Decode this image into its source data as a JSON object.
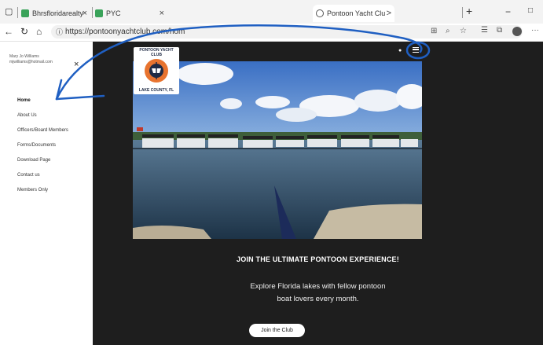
{
  "browser": {
    "tabs": [
      {
        "label": "Bhrsfloridarealty",
        "close": "×"
      },
      {
        "label": "PYC",
        "close": "×"
      },
      {
        "label": "Pontoon Yacht Clu",
        "close": ">"
      }
    ],
    "new_tab": "+",
    "minimize": "−",
    "restore": "□",
    "url": "https://pontoonyachtclub.com/hom",
    "more": "···"
  },
  "sidebar": {
    "user_name": "Mary Jo Williams",
    "user_email": "mjwilliams@hotmail.com",
    "close": "×",
    "items": [
      {
        "label": "Home"
      },
      {
        "label": "About Us"
      },
      {
        "label": "Officers/Board Members"
      },
      {
        "label": "Forms/Documents"
      },
      {
        "label": "Download Page"
      },
      {
        "label": "Contact us"
      },
      {
        "label": "Members Only"
      }
    ]
  },
  "logo": {
    "top_text": "PONTOON YACHT CLUB",
    "bottom_text": "LAKE COUNTY, FL"
  },
  "hero": {
    "headline": "JOIN THE ULTIMATE PONTOON EXPERIENCE!",
    "subtext_line1": "Explore Florida lakes with fellow pontoon",
    "subtext_line2": "boat lovers every month.",
    "cta": "Join the Club"
  },
  "colors": {
    "main_bg": "#1e1e1e",
    "annotation": "#1f5fc2",
    "sky": "#3f77c9",
    "water": "#2a4258"
  }
}
